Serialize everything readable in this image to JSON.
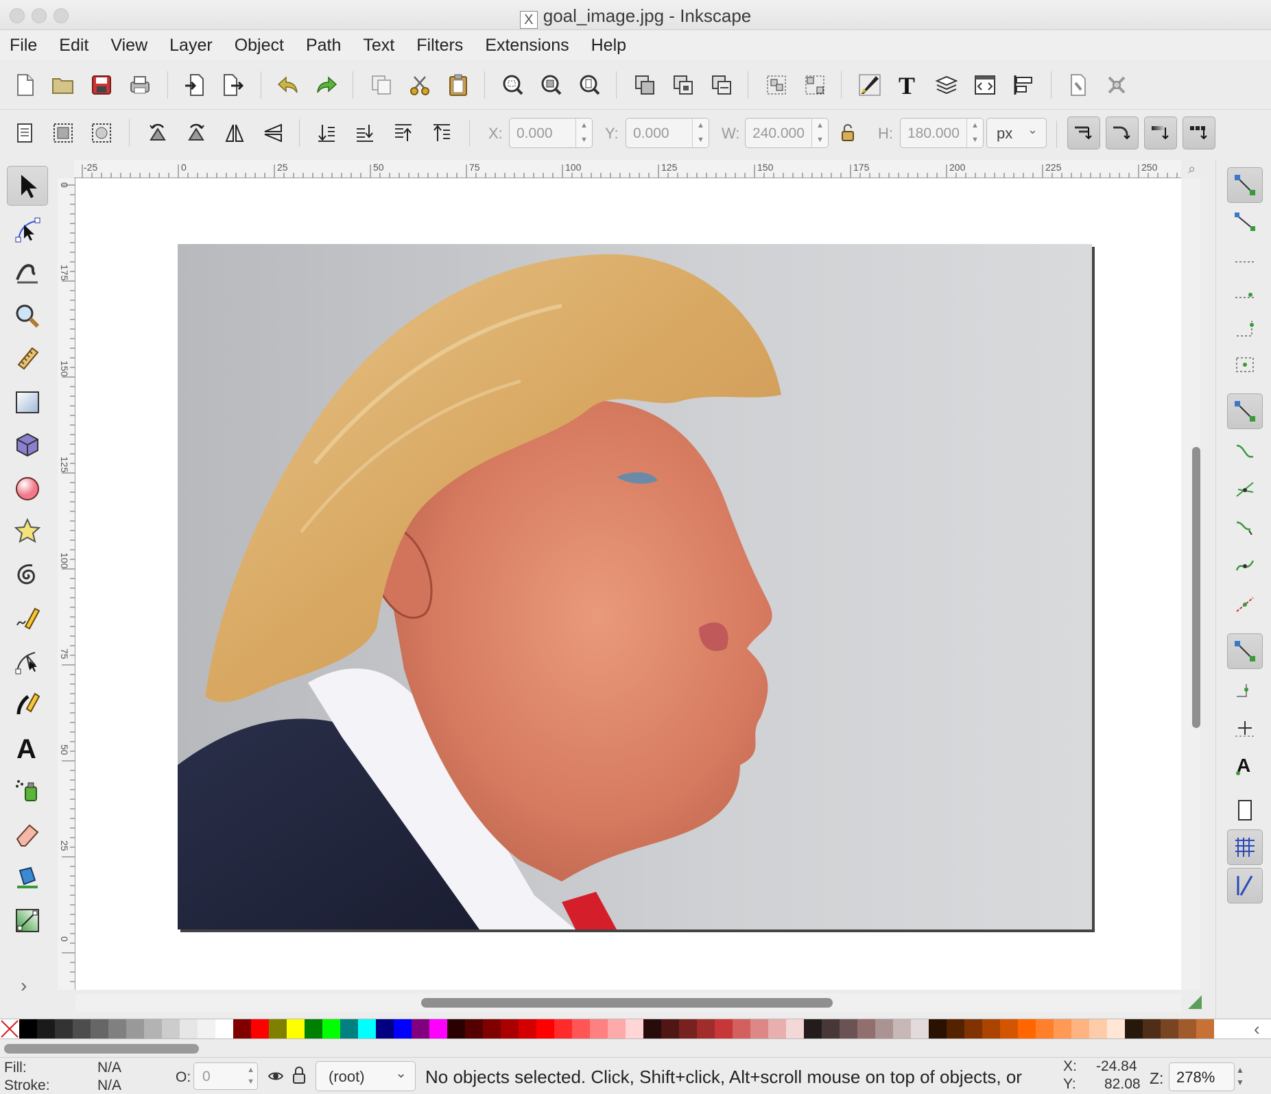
{
  "window": {
    "title": "goal_image.jpg - Inkscape",
    "x_glyph": "X"
  },
  "menu": [
    "File",
    "Edit",
    "View",
    "Layer",
    "Object",
    "Path",
    "Text",
    "Filters",
    "Extensions",
    "Help"
  ],
  "toolbar": {
    "icons": [
      "new-document",
      "open",
      "save",
      "print",
      "import",
      "export",
      "undo",
      "redo",
      "duplicate",
      "cut",
      "paste",
      "zoom-selection",
      "zoom-drawing",
      "zoom-page",
      "duplicate-object",
      "clone",
      "unlink-clone",
      "group",
      "ungroup",
      "fill-stroke",
      "text-font",
      "layers",
      "xml-editor",
      "align-distribute",
      "document-properties",
      "preferences"
    ]
  },
  "selector_controls": {
    "x_label": "X:",
    "x_value": "0.000",
    "y_label": "Y:",
    "y_value": "0.000",
    "w_label": "W:",
    "w_value": "240.000",
    "h_label": "H:",
    "h_value": "180.000",
    "unit": "px"
  },
  "tools": [
    "selector",
    "node",
    "tweak",
    "zoom",
    "measure",
    "rectangle",
    "3d-box",
    "ellipse",
    "star",
    "spiral",
    "pencil",
    "pen",
    "calligraphy",
    "text",
    "spray",
    "eraser",
    "paint-bucket",
    "gradient"
  ],
  "active_tool": "selector",
  "rulers": {
    "horizontal": [
      "-25",
      "0",
      "25",
      "50",
      "75",
      "100",
      "125",
      "150",
      "175",
      "200",
      "225",
      "250"
    ],
    "vertical": [
      "0",
      "175",
      "150",
      "125",
      "100",
      "75",
      "50",
      "25",
      "0"
    ]
  },
  "canvas": {
    "image_name": "goal_image.jpg"
  },
  "palette_colors": [
    "#000000",
    "#1a1a1a",
    "#333333",
    "#4d4d4d",
    "#666666",
    "#808080",
    "#999999",
    "#b3b3b3",
    "#cccccc",
    "#e6e6e6",
    "#f2f2f2",
    "#ffffff",
    "#800000",
    "#ff0000",
    "#808000",
    "#ffff00",
    "#008000",
    "#00ff00",
    "#008080",
    "#00ffff",
    "#000080",
    "#0000ff",
    "#800080",
    "#ff00ff",
    "#2b0000",
    "#550000",
    "#800000",
    "#aa0000",
    "#d40000",
    "#ff0000",
    "#ff2a2a",
    "#ff5555",
    "#ff8080",
    "#ffaaaa",
    "#ffd5d5",
    "#280b0b",
    "#501616",
    "#782121",
    "#a02c2c",
    "#c83737",
    "#d35f5f",
    "#de8787",
    "#e9afaf",
    "#f4d7d7",
    "#241c1c",
    "#483737",
    "#6c5353",
    "#916f6f",
    "#ac9393",
    "#c8b7b7",
    "#e3dbdb",
    "#2b1100",
    "#552200",
    "#803300",
    "#aa4400",
    "#d45500",
    "#ff6600",
    "#ff7f2a",
    "#ff9955",
    "#ffb380",
    "#ffccaa",
    "#ffe6d5",
    "#28170b",
    "#502d16",
    "#784421",
    "#a05a2c",
    "#c87137"
  ],
  "status": {
    "fill_label": "Fill:",
    "fill_value": "N/A",
    "stroke_label": "Stroke:",
    "stroke_value": "N/A",
    "opacity_label": "O:",
    "opacity_value": "0",
    "layer": "(root)",
    "message": "No objects selected. Click, Shift+click, Alt+scroll mouse on top of objects, or",
    "cursor_x_label": "X:",
    "cursor_x": "-24.84",
    "cursor_y_label": "Y:",
    "cursor_y": "82.08",
    "zoom_label": "Z:",
    "zoom": "278%"
  }
}
